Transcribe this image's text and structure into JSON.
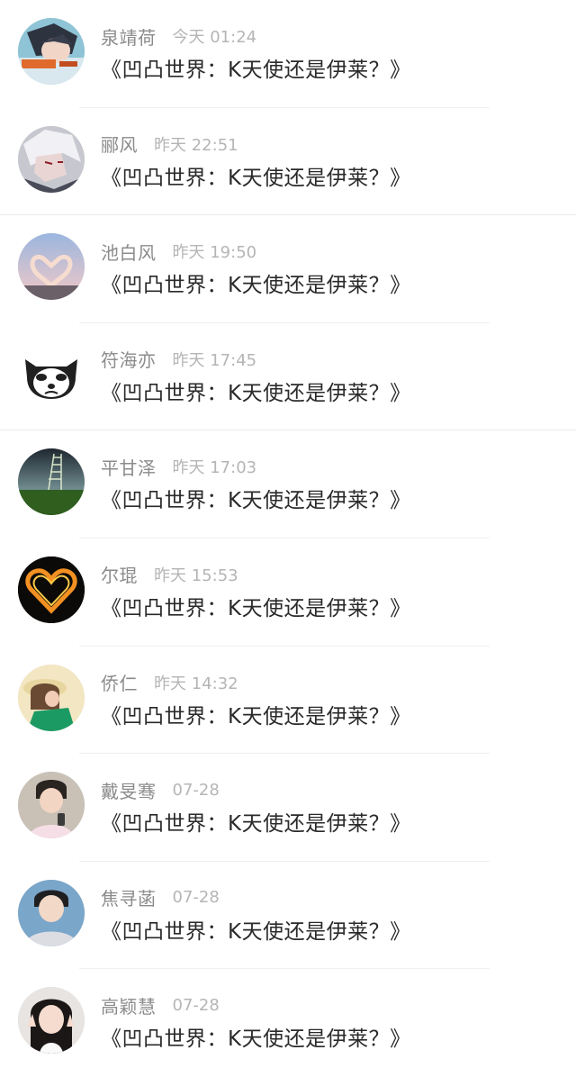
{
  "comments": [
    {
      "name": "泉靖荷",
      "time": "今天 01:24",
      "message": "《凹凸世界：K天使还是伊莱？》",
      "avatar": "anime-character-avatar"
    },
    {
      "name": "郦风",
      "time": "昨天 22:51",
      "message": "《凹凸世界：K天使还是伊莱？》",
      "avatar": "anime-white-hair-avatar"
    },
    {
      "name": "池白风",
      "time": "昨天 19:50",
      "message": "《凹凸世界：K天使还是伊莱？》",
      "avatar": "heart-hands-sky-avatar"
    },
    {
      "name": "符海亦",
      "time": "昨天 17:45",
      "message": "《凹凸世界：K天使还是伊莱？》",
      "avatar": "grumpy-panda-avatar"
    },
    {
      "name": "平甘泽",
      "time": "昨天 17:03",
      "message": "《凹凸世界：K天使还是伊莱？》",
      "avatar": "grass-ladder-sky-avatar"
    },
    {
      "name": "尔琨",
      "time": "昨天 15:53",
      "message": "《凹凸世界：K天使还是伊莱？》",
      "avatar": "fire-heart-avatar"
    },
    {
      "name": "侨仁",
      "time": "昨天 14:32",
      "message": "《凹凸世界：K天使还是伊莱？》",
      "avatar": "girl-hat-avatar"
    },
    {
      "name": "戴旻骞",
      "time": "07-28",
      "message": "《凹凸世界：K天使还是伊莱？》",
      "avatar": "boy-mirror-selfie-avatar"
    },
    {
      "name": "焦寻菡",
      "time": "07-28",
      "message": "《凹凸世界：K天使还是伊莱？》",
      "avatar": "boy-portrait-avatar"
    },
    {
      "name": "高颖慧",
      "time": "07-28",
      "message": "《凹凸世界：K天使还是伊莱？》",
      "avatar": "girl-peace-sign-avatar"
    }
  ]
}
